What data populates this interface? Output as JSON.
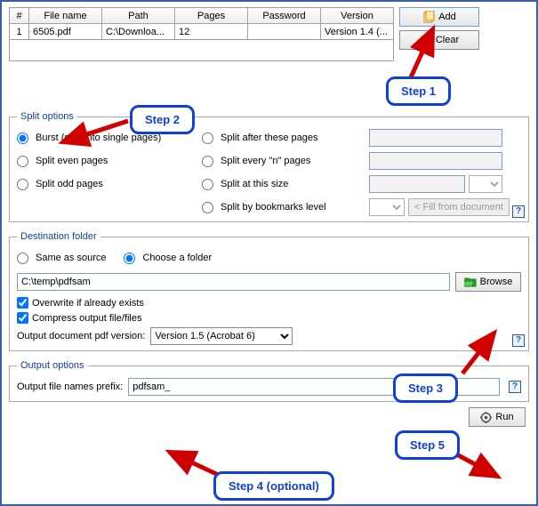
{
  "table": {
    "headers": {
      "num": "#",
      "filename": "File name",
      "path": "Path",
      "pages": "Pages",
      "password": "Password",
      "version": "Version"
    },
    "row": {
      "num": "1",
      "filename": "6505.pdf",
      "path": "C:\\Downloa...",
      "pages": "12",
      "password": "",
      "version": "Version 1.4 (..."
    }
  },
  "buttons": {
    "add": "Add",
    "clear": "Clear",
    "browse": "Browse",
    "run": "Run",
    "fill_from_doc": "< Fill from document"
  },
  "split": {
    "legend": "Split options",
    "burst": "Burst (split into single pages)",
    "even": "Split even pages",
    "odd": "Split odd pages",
    "after": "Split after these pages",
    "every_n": "Split every \"n\" pages",
    "at_size": "Split at this size",
    "bookmarks": "Split by bookmarks level"
  },
  "dest": {
    "legend": "Destination folder",
    "same": "Same as source",
    "choose": "Choose a folder",
    "path": "C:\\temp\\pdfsam",
    "overwrite": "Overwrite if already exists",
    "compress": "Compress output file/files",
    "version_label": "Output document pdf version:",
    "version_value": "Version 1.5 (Acrobat 6)"
  },
  "output": {
    "legend": "Output options",
    "prefix_label": "Output file names prefix:",
    "prefix_value": "pdfsam_"
  },
  "steps": {
    "s1": "Step 1",
    "s2": "Step 2",
    "s3": "Step 3",
    "s4": "Step 4 (optional)",
    "s5": "Step 5"
  },
  "help": "?"
}
